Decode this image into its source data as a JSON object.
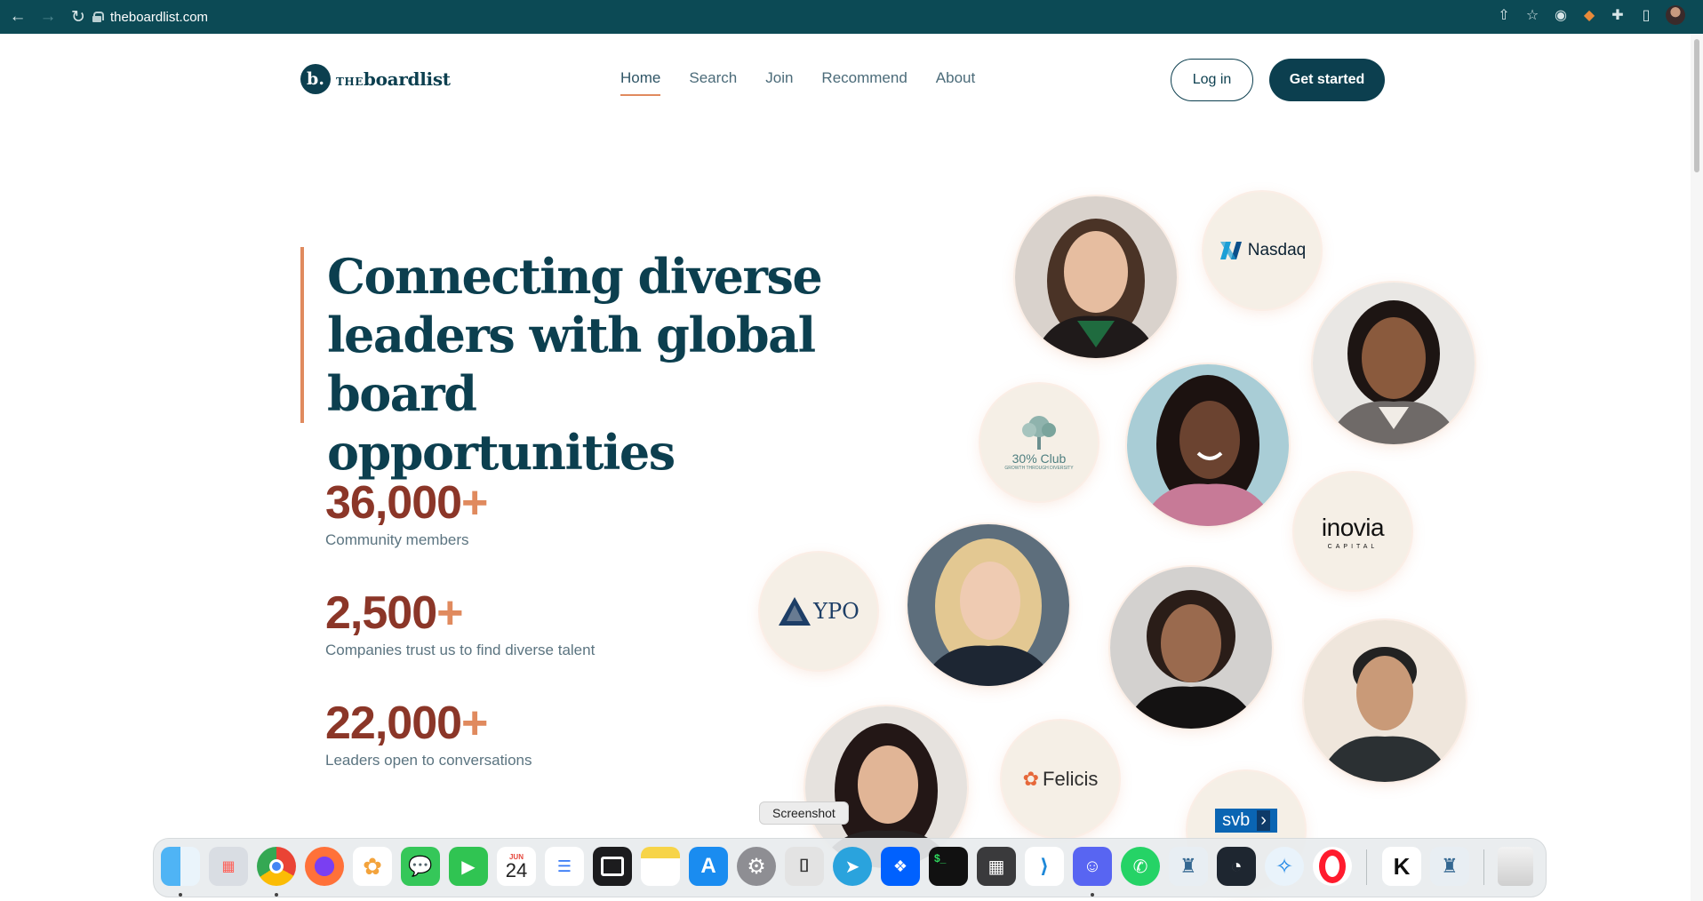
{
  "browser": {
    "url": "theboardlist.com",
    "back_icon": "←",
    "forward_icon": "→",
    "reload_icon": "↻"
  },
  "header": {
    "logo_mark": "b.",
    "logo_small": "THE",
    "logo_main": "boardlist",
    "nav": [
      {
        "label": "Home",
        "active": true
      },
      {
        "label": "Search"
      },
      {
        "label": "Join"
      },
      {
        "label": "Recommend"
      },
      {
        "label": "About"
      }
    ],
    "login_label": "Log in",
    "start_label": "Get started"
  },
  "hero": {
    "title": "Connecting diverse leaders with global board opportunities",
    "stats": [
      {
        "value": "36,000",
        "plus": "+",
        "label": "Community members"
      },
      {
        "value": "2,500",
        "plus": "+",
        "label": "Companies trust us to find diverse talent"
      },
      {
        "value": "22,000",
        "plus": "+",
        "label": "Leaders open to conversations"
      }
    ]
  },
  "partners": {
    "nasdaq": "Nasdaq",
    "club": "30% Club",
    "club_sub": "GROWTH THROUGH DIVERSITY",
    "inovia": "inovia",
    "inovia_sub": "CAPITAL",
    "ypo": "YPO",
    "felicis": "Felicis",
    "svb": "svb"
  },
  "dock": {
    "tooltip": "Screenshot",
    "calendar_month": "JUN",
    "calendar_day": "24"
  },
  "colors": {
    "brand": "#0c3f4f",
    "accent": "#e08a5e",
    "stat": "#8b3628"
  }
}
